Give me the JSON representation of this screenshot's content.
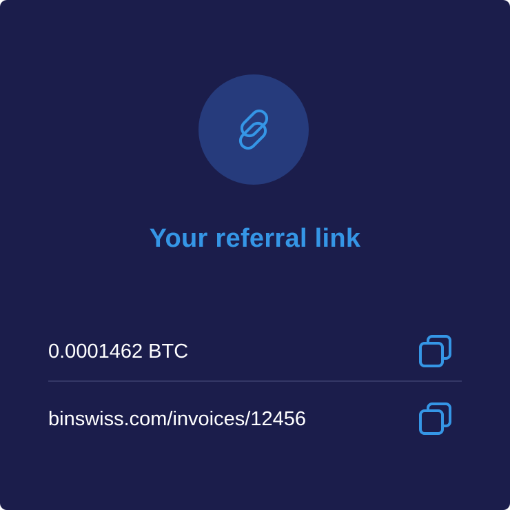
{
  "card": {
    "title": "Your referral link",
    "icon": "link-icon",
    "accent_color": "#3596e6",
    "background_color": "#1b1d4b"
  },
  "rows": [
    {
      "text": "0.0001462 BTC",
      "action_icon": "copy-icon"
    },
    {
      "text": "binswiss.com/invoices/12456",
      "action_icon": "copy-icon"
    }
  ]
}
